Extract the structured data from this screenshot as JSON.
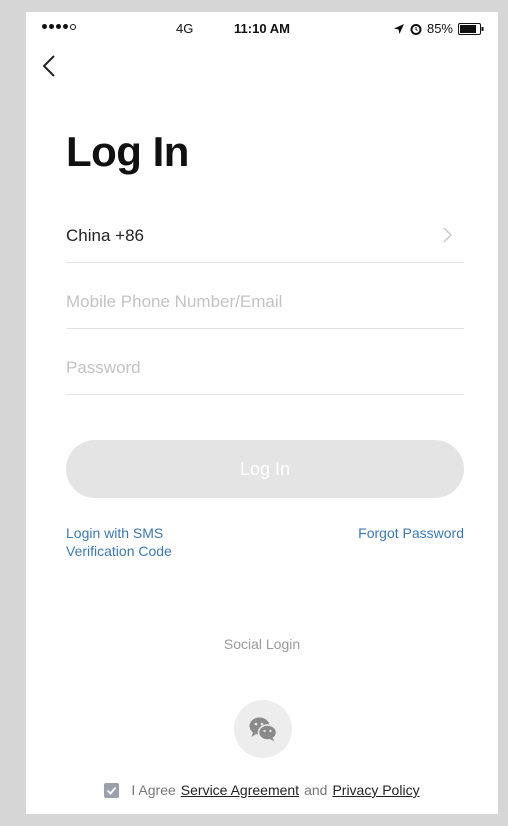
{
  "status_bar": {
    "network": "4G",
    "time": "11:10 AM",
    "battery": "85%"
  },
  "page": {
    "title": "Log In"
  },
  "form": {
    "country": "China +86",
    "phone_placeholder": "Mobile Phone Number/Email",
    "password_placeholder": "Password",
    "login_label": "Log In"
  },
  "links": {
    "sms_login": "Login with SMS Verification Code",
    "forgot_password": "Forgot Password"
  },
  "social": {
    "label": "Social Login",
    "icon": "wechat-icon"
  },
  "agreement": {
    "checked": true,
    "prefix": "I Agree",
    "service": "Service Agreement",
    "and": "and",
    "privacy": "Privacy Policy"
  },
  "colors": {
    "link": "#3b78b4",
    "button_disabled": "#e4e4e4",
    "checkbox": "#9aa1ad"
  }
}
